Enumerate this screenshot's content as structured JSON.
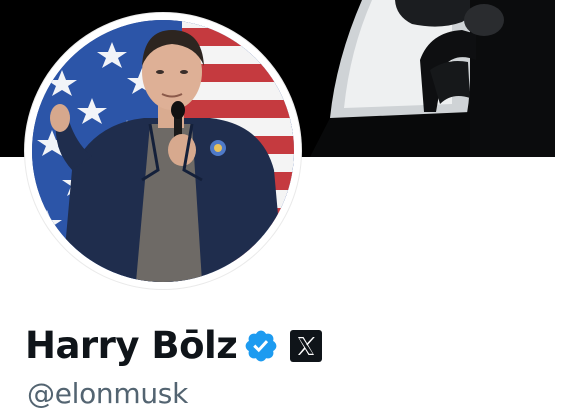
{
  "profile": {
    "display_name": "Harry Bōlz",
    "handle": "@elonmusk"
  },
  "icons": {
    "verified": "verified-checkmark-badge-icon",
    "affiliation": "x-logo-icon"
  },
  "colors": {
    "verified_blue": "#1d9bf0",
    "name_text": "#0f1419",
    "handle_text": "#536471",
    "banner_bg": "#000000"
  }
}
